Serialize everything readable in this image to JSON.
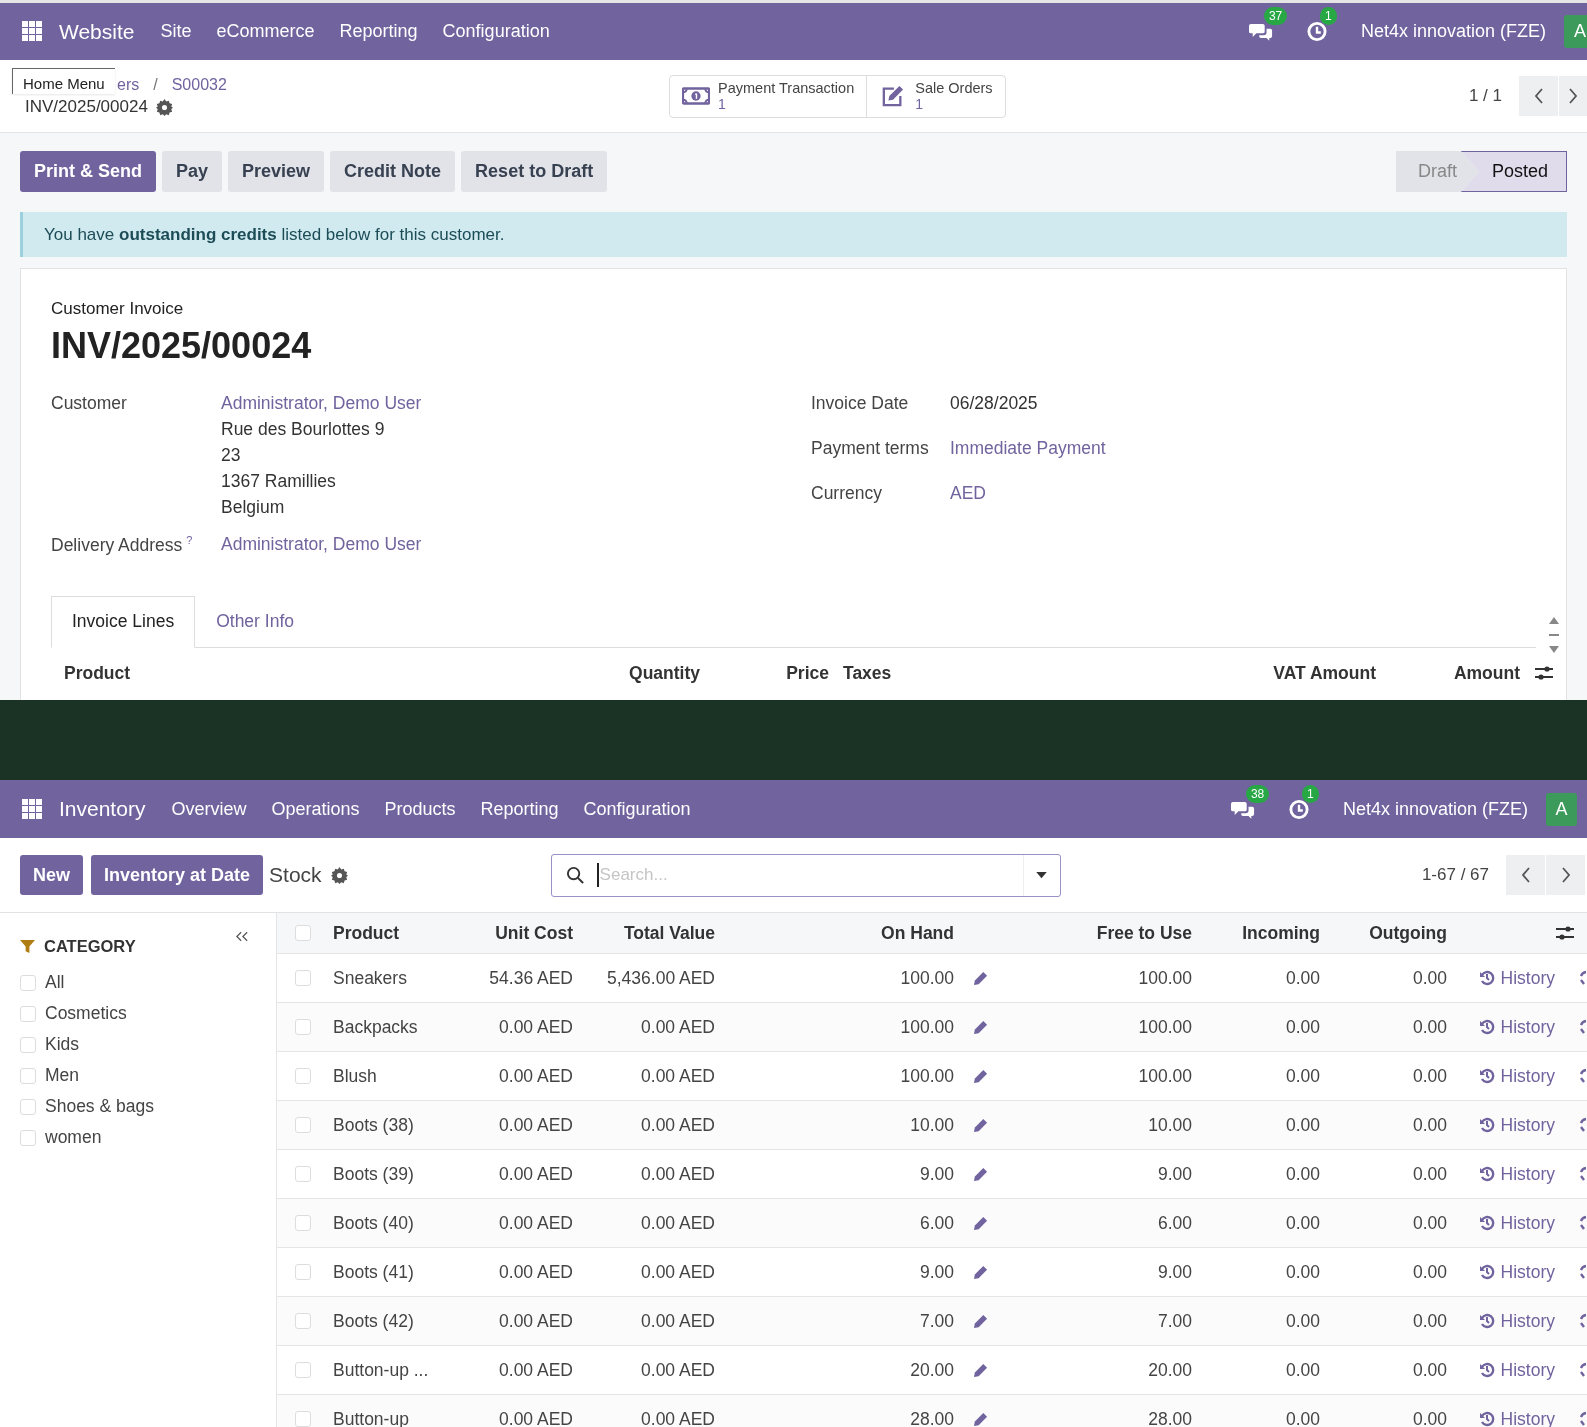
{
  "invoice_window": {
    "navbar": {
      "app": "Website",
      "menu": [
        "Site",
        "eCommerce",
        "Reporting",
        "Configuration"
      ],
      "messages_count": "37",
      "activities_count": "1",
      "company": "Net4x innovation (FZE)",
      "avatar": "A"
    },
    "tooltip": "Home Menu",
    "breadcrumb": [
      "ers",
      "S00032"
    ],
    "breadcrumb_separator": "/",
    "record": "INV/2025/00024",
    "smart_buttons": [
      {
        "kind": "money",
        "label": "Payment Transaction",
        "count": "1"
      },
      {
        "kind": "edit",
        "label": "Sale Orders",
        "count": "1"
      }
    ],
    "pager": "1 / 1",
    "actions": [
      {
        "label": "Print & Send",
        "primary": true
      },
      {
        "label": "Pay",
        "primary": false
      },
      {
        "label": "Preview",
        "primary": false
      },
      {
        "label": "Credit Note",
        "primary": false
      },
      {
        "label": "Reset to Draft",
        "primary": false
      }
    ],
    "status": [
      {
        "label": "Draft",
        "selected": false
      },
      {
        "label": "Posted",
        "selected": true
      }
    ],
    "alert": "You have **outstanding credits** listed below for this customer.",
    "doc_type": "Customer Invoice",
    "number": "INV/2025/00024",
    "left_fields": [
      {
        "label": "Customer",
        "value": "Administrator, Demo User",
        "lines": [
          "Rue des Bourlottes 9",
          "23",
          "1367 Ramillies",
          "Belgium"
        ]
      },
      {
        "label": "Delivery Address",
        "help": "?",
        "value": "Administrator, Demo User"
      }
    ],
    "right_fields": [
      {
        "label": "Invoice Date",
        "value": "06/28/2025",
        "link": false
      },
      {
        "label": "Payment terms",
        "value": "Immediate Payment",
        "link": true
      },
      {
        "label": "Currency",
        "value": "AED",
        "link": true
      }
    ],
    "tabs": [
      {
        "label": "Invoice Lines",
        "selected": true
      },
      {
        "label": "Other Info",
        "selected": false
      }
    ],
    "columns": [
      "Product",
      "Quantity",
      "Price",
      "Taxes",
      "VAT Amount",
      "Amount"
    ]
  },
  "inventory_window": {
    "navbar": {
      "app": "Inventory",
      "menu": [
        "Overview",
        "Operations",
        "Products",
        "Reporting",
        "Configuration"
      ],
      "messages_count": "38",
      "activities_count": "1",
      "company": "Net4x innovation (FZE)",
      "avatar": "A"
    },
    "buttons": [
      "New",
      "Inventory at Date"
    ],
    "title": "Stock",
    "search": {
      "placeholder": "Search..."
    },
    "pager": "1-67 / 67",
    "filter_title": "CATEGORY",
    "categories": [
      {
        "label": "All",
        "checked": false
      },
      {
        "label": "Cosmetics",
        "checked": false
      },
      {
        "label": "Kids",
        "checked": false
      },
      {
        "label": "Men",
        "checked": false
      },
      {
        "label": "Shoes & bags",
        "checked": false
      },
      {
        "label": "women",
        "checked": false
      }
    ],
    "columns": [
      "Product",
      "Unit Cost",
      "Total Value",
      "On Hand",
      "Free to Use",
      "Incoming",
      "Outgoing"
    ],
    "select_all_checked": false,
    "rows": [
      {
        "checked": false,
        "product": "Sneakers",
        "unit_cost": "54.36 AED",
        "total_value": "5,436.00 AED",
        "on_hand": "100.00",
        "free": "100.00",
        "incoming": "0.00",
        "outgoing": "0.00",
        "action": "History"
      },
      {
        "checked": false,
        "product": "Backpacks",
        "unit_cost": "0.00 AED",
        "total_value": "0.00 AED",
        "on_hand": "100.00",
        "free": "100.00",
        "incoming": "0.00",
        "outgoing": "0.00",
        "action": "History"
      },
      {
        "checked": false,
        "product": "Blush",
        "unit_cost": "0.00 AED",
        "total_value": "0.00 AED",
        "on_hand": "100.00",
        "free": "100.00",
        "incoming": "0.00",
        "outgoing": "0.00",
        "action": "History"
      },
      {
        "checked": false,
        "product": "Boots (38)",
        "unit_cost": "0.00 AED",
        "total_value": "0.00 AED",
        "on_hand": "10.00",
        "free": "10.00",
        "incoming": "0.00",
        "outgoing": "0.00",
        "action": "History"
      },
      {
        "checked": false,
        "product": "Boots (39)",
        "unit_cost": "0.00 AED",
        "total_value": "0.00 AED",
        "on_hand": "9.00",
        "free": "9.00",
        "incoming": "0.00",
        "outgoing": "0.00",
        "action": "History"
      },
      {
        "checked": false,
        "product": "Boots (40)",
        "unit_cost": "0.00 AED",
        "total_value": "0.00 AED",
        "on_hand": "6.00",
        "free": "6.00",
        "incoming": "0.00",
        "outgoing": "0.00",
        "action": "History"
      },
      {
        "checked": false,
        "product": "Boots (41)",
        "unit_cost": "0.00 AED",
        "total_value": "0.00 AED",
        "on_hand": "9.00",
        "free": "9.00",
        "incoming": "0.00",
        "outgoing": "0.00",
        "action": "History"
      },
      {
        "checked": false,
        "product": "Boots (42)",
        "unit_cost": "0.00 AED",
        "total_value": "0.00 AED",
        "on_hand": "7.00",
        "free": "7.00",
        "incoming": "0.00",
        "outgoing": "0.00",
        "action": "History"
      },
      {
        "checked": false,
        "product": "Button-up ...",
        "unit_cost": "0.00 AED",
        "total_value": "0.00 AED",
        "on_hand": "20.00",
        "free": "20.00",
        "incoming": "0.00",
        "outgoing": "0.00",
        "action": "History"
      },
      {
        "checked": false,
        "product": "Button-up",
        "unit_cost": "0.00 AED",
        "total_value": "0.00 AED",
        "on_hand": "28.00",
        "free": "28.00",
        "incoming": "0.00",
        "outgoing": "0.00",
        "action": "History"
      }
    ]
  }
}
